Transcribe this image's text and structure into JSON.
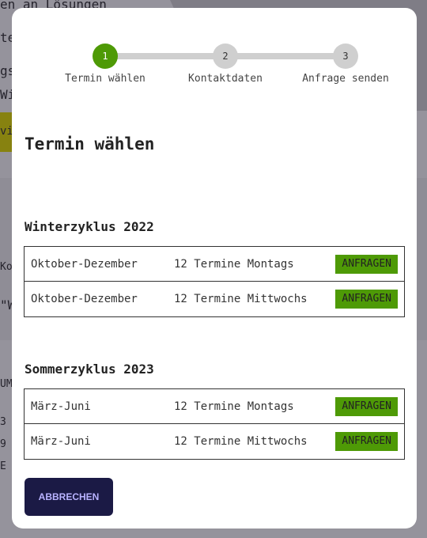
{
  "background": {
    "snippets": [
      "en an Lösungen",
      "ter",
      "gs",
      "Wi",
      "vi",
      "Ko",
      "\"W",
      "UM",
      "3",
      "9",
      "E"
    ]
  },
  "stepper": {
    "steps": [
      {
        "number": "1",
        "label": "Termin wählen",
        "active": true
      },
      {
        "number": "2",
        "label": "Kontaktdaten",
        "active": false
      },
      {
        "number": "3",
        "label": "Anfrage senden",
        "active": false
      }
    ]
  },
  "title": "Termin wählen",
  "sections": [
    {
      "title": "Winterzyklus 2022",
      "rows": [
        {
          "range": "Oktober-Dezember",
          "count": "12 Termine Montags",
          "button": "ANFRAGEN"
        },
        {
          "range": "Oktober-Dezember",
          "count": "12 Termine Mittwochs",
          "button": "ANFRAGEN"
        }
      ]
    },
    {
      "title": "Sommerzyklus 2023",
      "rows": [
        {
          "range": "März-Juni",
          "count": "12 Termine Montags",
          "button": "ANFRAGEN"
        },
        {
          "range": "März-Juni",
          "count": "12 Termine Mittwochs",
          "button": "ANFRAGEN"
        }
      ]
    }
  ],
  "cancel_label": "ABBRECHEN",
  "colors": {
    "accent_green": "#4e9a06",
    "inactive_step": "#cfcfcf",
    "cancel_bg": "#1b1a45",
    "cancel_text": "#b9b3ff"
  }
}
